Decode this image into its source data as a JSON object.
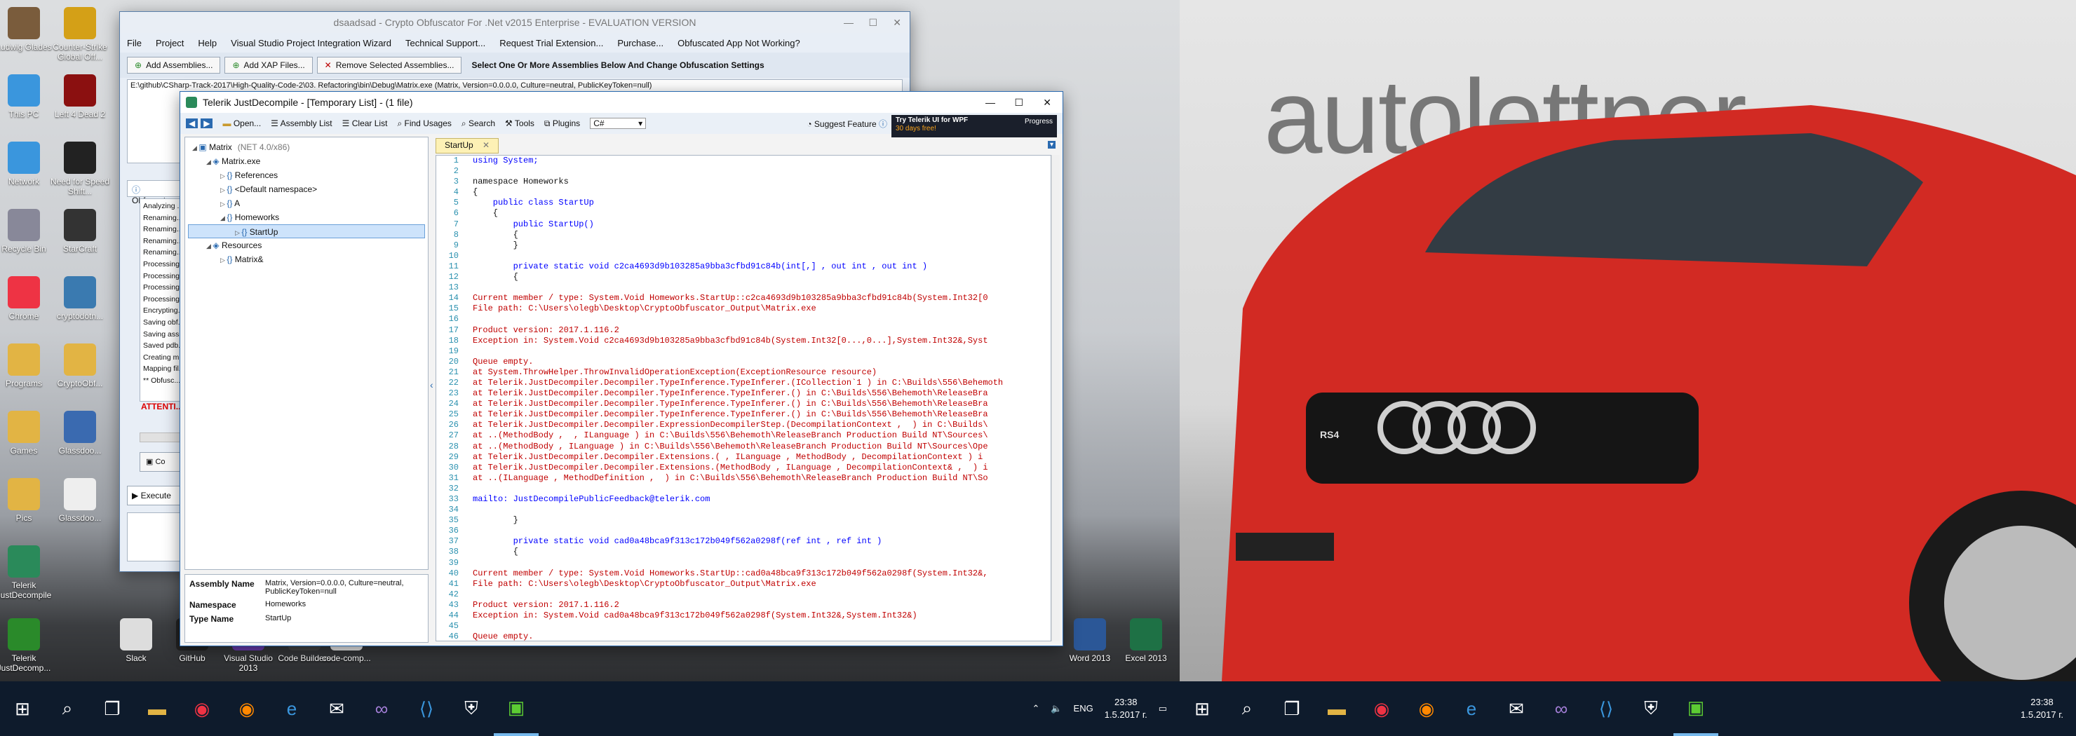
{
  "desktop_icons": [
    {
      "label": "Ludwig Glades"
    },
    {
      "label": "Counter-Strike Global Off..."
    },
    {
      "label": "This PC"
    },
    {
      "label": "Left 4 Dead 2"
    },
    {
      "label": "Network"
    },
    {
      "label": "Need for Speed Shift..."
    },
    {
      "label": "Recycle Bin"
    },
    {
      "label": "StarCraft"
    },
    {
      "label": "Chrome"
    },
    {
      "label": "cryptodotn..."
    },
    {
      "label": "Programs"
    },
    {
      "label": "CryptoObf..."
    },
    {
      "label": "Games"
    },
    {
      "label": "Glassdoo..."
    },
    {
      "label": "Pics"
    },
    {
      "label": "Glassdoo..."
    },
    {
      "label": "Telerik JustDecompile"
    },
    {
      "label": "Telerik JustDecomp..."
    },
    {
      "label": "Slack"
    },
    {
      "label": "GitHub"
    },
    {
      "label": "Visual Studio 2013"
    },
    {
      "label": "Code Builders"
    },
    {
      "label": "code-comp..."
    },
    {
      "label": "Word 2013"
    },
    {
      "label": "Excel 2013"
    }
  ],
  "crypto": {
    "title": "dsaadsad - Crypto Obfuscator For .Net v2015 Enterprise - EVALUATION VERSION",
    "menu": [
      "File",
      "Project",
      "Help",
      "Visual Studio Project Integration Wizard",
      "Technical Support...",
      "Request Trial Extension...",
      "Purchase...",
      "Obfuscated App Not Working?"
    ],
    "tools": [
      "Add Assemblies...",
      "Add XAP Files...",
      "Remove Selected Assemblies..."
    ],
    "hint": "Select One Or More Assemblies Below And Change Obfuscation Settings",
    "assembly_path": "E:\\github\\CSharp-Track-2017\\High-Quality-Code-2\\03. Refactoring\\bin\\Debug\\Matrix.exe (Matrix, Version=0.0.0.0, Culture=neutral, PublicKeyToken=null)",
    "section": "Obfuscat...",
    "log": [
      "Analyzing ...",
      "Renaming...",
      "Renaming...",
      "Renaming...",
      "Renaming...",
      "Processing...",
      "Processing...",
      "Processing...",
      "Processing...",
      "Encrypting...",
      "Saving obf...",
      "Saving ass...",
      "Saved pdb...",
      "Creating m...",
      "Mapping fil...",
      "** Obfusc..."
    ],
    "attention": "ATTENTI...",
    "execute": "Execute",
    "co": "Co"
  },
  "jd": {
    "title": "Telerik JustDecompile - [Temporary List] - (1 file)",
    "toolbar": [
      "Open...",
      "Assembly List",
      "Clear List",
      "Find Usages",
      "Search",
      "Tools",
      "Plugins"
    ],
    "lang": "C#",
    "suggest": "Suggest Feature",
    "ad_line1": "Try Telerik UI for WPF",
    "ad_line2": "30 days free!",
    "ad_brand": "Progress",
    "tree": [
      {
        "label": "Matrix",
        "extra": "(NET 4.0/x86)",
        "indent": 0
      },
      {
        "label": "Matrix.exe",
        "extra": "",
        "indent": 1
      },
      {
        "label": "References",
        "extra": "",
        "indent": 2
      },
      {
        "label": "<Default namespace>",
        "extra": "",
        "indent": 2
      },
      {
        "label": "A",
        "extra": "",
        "indent": 2
      },
      {
        "label": "Homeworks",
        "extra": "",
        "indent": 2
      },
      {
        "label": "StartUp",
        "extra": "",
        "indent": 3
      },
      {
        "label": "Resources",
        "extra": "",
        "indent": 1
      },
      {
        "label": "Matrix&",
        "extra": "",
        "indent": 2
      }
    ],
    "props": [
      {
        "name": "Assembly Name",
        "value": "Matrix, Version=0.0.0.0, Culture=neutral, PublicKeyToken=null"
      },
      {
        "name": "Namespace",
        "value": "Homeworks"
      },
      {
        "name": "Type Name",
        "value": "StartUp"
      }
    ],
    "tab": "StartUp",
    "code": [
      {
        "n": "1",
        "t": "using System;",
        "c": "kw"
      },
      {
        "n": "2",
        "t": "",
        "c": ""
      },
      {
        "n": "3",
        "t": "namespace Homeworks",
        "c": ""
      },
      {
        "n": "4",
        "t": "{",
        "c": ""
      },
      {
        "n": "5",
        "t": "    public class StartUp",
        "c": "kw"
      },
      {
        "n": "6",
        "t": "    {",
        "c": ""
      },
      {
        "n": "7",
        "t": "        public StartUp()",
        "c": "kw"
      },
      {
        "n": "8",
        "t": "        {",
        "c": ""
      },
      {
        "n": "9",
        "t": "        }",
        "c": ""
      },
      {
        "n": "10",
        "t": "",
        "c": ""
      },
      {
        "n": "11",
        "t": "        private static void c2ca4693d9b103285a9bba3cfbd91c84b(int[,] , out int , out int )",
        "c": "kw"
      },
      {
        "n": "12",
        "t": "        {",
        "c": ""
      },
      {
        "n": "13",
        "t": "",
        "c": ""
      },
      {
        "n": "14",
        "t": "Current member / type: System.Void Homeworks.StartUp::c2ca4693d9b103285a9bba3cfbd91c84b(System.Int32[0",
        "c": "err"
      },
      {
        "n": "15",
        "t": "File path: C:\\Users\\olegb\\Desktop\\CryptoObfuscator_Output\\Matrix.exe",
        "c": "err"
      },
      {
        "n": "16",
        "t": "",
        "c": ""
      },
      {
        "n": "17",
        "t": "Product version: 2017.1.116.2",
        "c": "err"
      },
      {
        "n": "18",
        "t": "Exception in: System.Void c2ca4693d9b103285a9bba3cfbd91c84b(System.Int32[0...,0...],System.Int32&,Syst",
        "c": "err"
      },
      {
        "n": "19",
        "t": "",
        "c": ""
      },
      {
        "n": "20",
        "t": "Queue empty.",
        "c": "err"
      },
      {
        "n": "21",
        "t": "at System.ThrowHelper.ThrowInvalidOperationException(ExceptionResource resource)",
        "c": "err"
      },
      {
        "n": "22",
        "t": "at Telerik.JustDecompiler.Decompiler.TypeInference.TypeInferer.(ICollection`1 ) in C:\\Builds\\556\\Behemoth",
        "c": "err"
      },
      {
        "n": "23",
        "t": "at Telerik.JustDecompiler.Decompiler.TypeInference.TypeInferer.() in C:\\Builds\\556\\Behemoth\\ReleaseBra",
        "c": "err"
      },
      {
        "n": "24",
        "t": "at Telerik.JustDecompiler.Decompiler.TypeInference.TypeInferer.() in C:\\Builds\\556\\Behemoth\\ReleaseBra",
        "c": "err"
      },
      {
        "n": "25",
        "t": "at Telerik.JustDecompiler.Decompiler.TypeInference.TypeInferer.() in C:\\Builds\\556\\Behemoth\\ReleaseBra",
        "c": "err"
      },
      {
        "n": "26",
        "t": "at Telerik.JustDecompiler.Decompiler.ExpressionDecompilerStep.(DecompilationContext ,  ) in C:\\Builds\\",
        "c": "err"
      },
      {
        "n": "27",
        "t": "at ..(MethodBody ,  , ILanguage ) in C:\\Builds\\556\\Behemoth\\ReleaseBranch Production Build NT\\Sources\\",
        "c": "err"
      },
      {
        "n": "28",
        "t": "at ..(MethodBody , ILanguage ) in C:\\Builds\\556\\Behemoth\\ReleaseBranch Production Build NT\\Sources\\Ope",
        "c": "err"
      },
      {
        "n": "29",
        "t": "at Telerik.JustDecompiler.Decompiler.Extensions.( , ILanguage , MethodBody , DecompilationContext ) i",
        "c": "err"
      },
      {
        "n": "30",
        "t": "at Telerik.JustDecompiler.Decompiler.Extensions.(MethodBody , ILanguage , DecompilationContext& ,  ) i",
        "c": "err"
      },
      {
        "n": "31",
        "t": "at ..(ILanguage , MethodDefinition ,  ) in C:\\Builds\\556\\Behemoth\\ReleaseBranch Production Build NT\\So",
        "c": "err"
      },
      {
        "n": "32",
        "t": "",
        "c": ""
      },
      {
        "n": "33",
        "t": "mailto: JustDecompilePublicFeedback@telerik.com",
        "c": "lk"
      },
      {
        "n": "34",
        "t": "",
        "c": ""
      },
      {
        "n": "35",
        "t": "        }",
        "c": ""
      },
      {
        "n": "36",
        "t": "",
        "c": ""
      },
      {
        "n": "37",
        "t": "        private static void cad0a48bca9f313c172b049f562a0298f(ref int , ref int )",
        "c": "kw"
      },
      {
        "n": "38",
        "t": "        {",
        "c": ""
      },
      {
        "n": "39",
        "t": "",
        "c": ""
      },
      {
        "n": "40",
        "t": "Current member / type: System.Void Homeworks.StartUp::cad0a48bca9f313c172b049f562a0298f(System.Int32&,",
        "c": "err"
      },
      {
        "n": "41",
        "t": "File path: C:\\Users\\olegb\\Desktop\\CryptoObfuscator_Output\\Matrix.exe",
        "c": "err"
      },
      {
        "n": "42",
        "t": "",
        "c": ""
      },
      {
        "n": "43",
        "t": "Product version: 2017.1.116.2",
        "c": "err"
      },
      {
        "n": "44",
        "t": "Exception in: System.Void cad0a48bca9f313c172b049f562a0298f(System.Int32&,System.Int32&)",
        "c": "err"
      },
      {
        "n": "45",
        "t": "",
        "c": ""
      },
      {
        "n": "46",
        "t": "Queue empty.",
        "c": "err"
      }
    ]
  },
  "clock": {
    "time": "23:38",
    "date": "1.5.2017 г.",
    "lang": "ENG"
  },
  "bg_brand": "autolettner",
  "car_badge": "RS4"
}
